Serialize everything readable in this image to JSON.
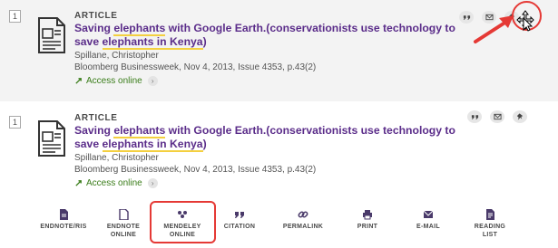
{
  "results": [
    {
      "index": "1",
      "type": "ARTICLE",
      "title_parts": [
        {
          "text": "Saving ",
          "hl": false
        },
        {
          "text": "elephants",
          "hl": true
        },
        {
          "text": " with Google Earth.(conservationists use technology to save ",
          "hl": false
        },
        {
          "text": "elephants in Kenya",
          "hl": true
        },
        {
          "text": ")",
          "hl": false
        }
      ],
      "author": "Spillane, Christopher",
      "source": "Bloomberg Businessweek, Nov 4, 2013, Issue 4353, p.43(2)",
      "access": "Access online"
    },
    {
      "index": "1",
      "type": "ARTICLE",
      "title_parts": [
        {
          "text": "Saving ",
          "hl": false
        },
        {
          "text": "elephants",
          "hl": true
        },
        {
          "text": " with Google Earth.(conservationists use technology to save ",
          "hl": false
        },
        {
          "text": "elephants in Kenya",
          "hl": true
        },
        {
          "text": ")",
          "hl": false
        }
      ],
      "author": "Spillane, Christopher",
      "source": "Bloomberg Businessweek, Nov 4, 2013, Issue 4353, p.43(2)",
      "access": "Access online"
    }
  ],
  "action_icons": [
    "quote-icon",
    "email-icon",
    "pin-icon"
  ],
  "toolbar": [
    {
      "label": "ENDNOTE/RIS",
      "icon": "endnote-ris-icon"
    },
    {
      "label": "ENDNOTE\nONLINE",
      "icon": "endnote-online-icon"
    },
    {
      "label": "MENDELEY\nONLINE",
      "icon": "mendeley-icon"
    },
    {
      "label": "CITATION",
      "icon": "quote-icon"
    },
    {
      "label": "PERMALINK",
      "icon": "link-icon"
    },
    {
      "label": "PRINT",
      "icon": "print-icon"
    },
    {
      "label": "E-MAIL",
      "icon": "email-icon"
    },
    {
      "label": "READING\nLIST",
      "icon": "reading-list-icon"
    }
  ],
  "colors": {
    "title": "#5b2d8a",
    "highlight_underline": "#f4d03f",
    "access_green": "#3a7d1a",
    "annotation_red": "#e53935",
    "toolbar_highlight": "#d32f2f"
  }
}
